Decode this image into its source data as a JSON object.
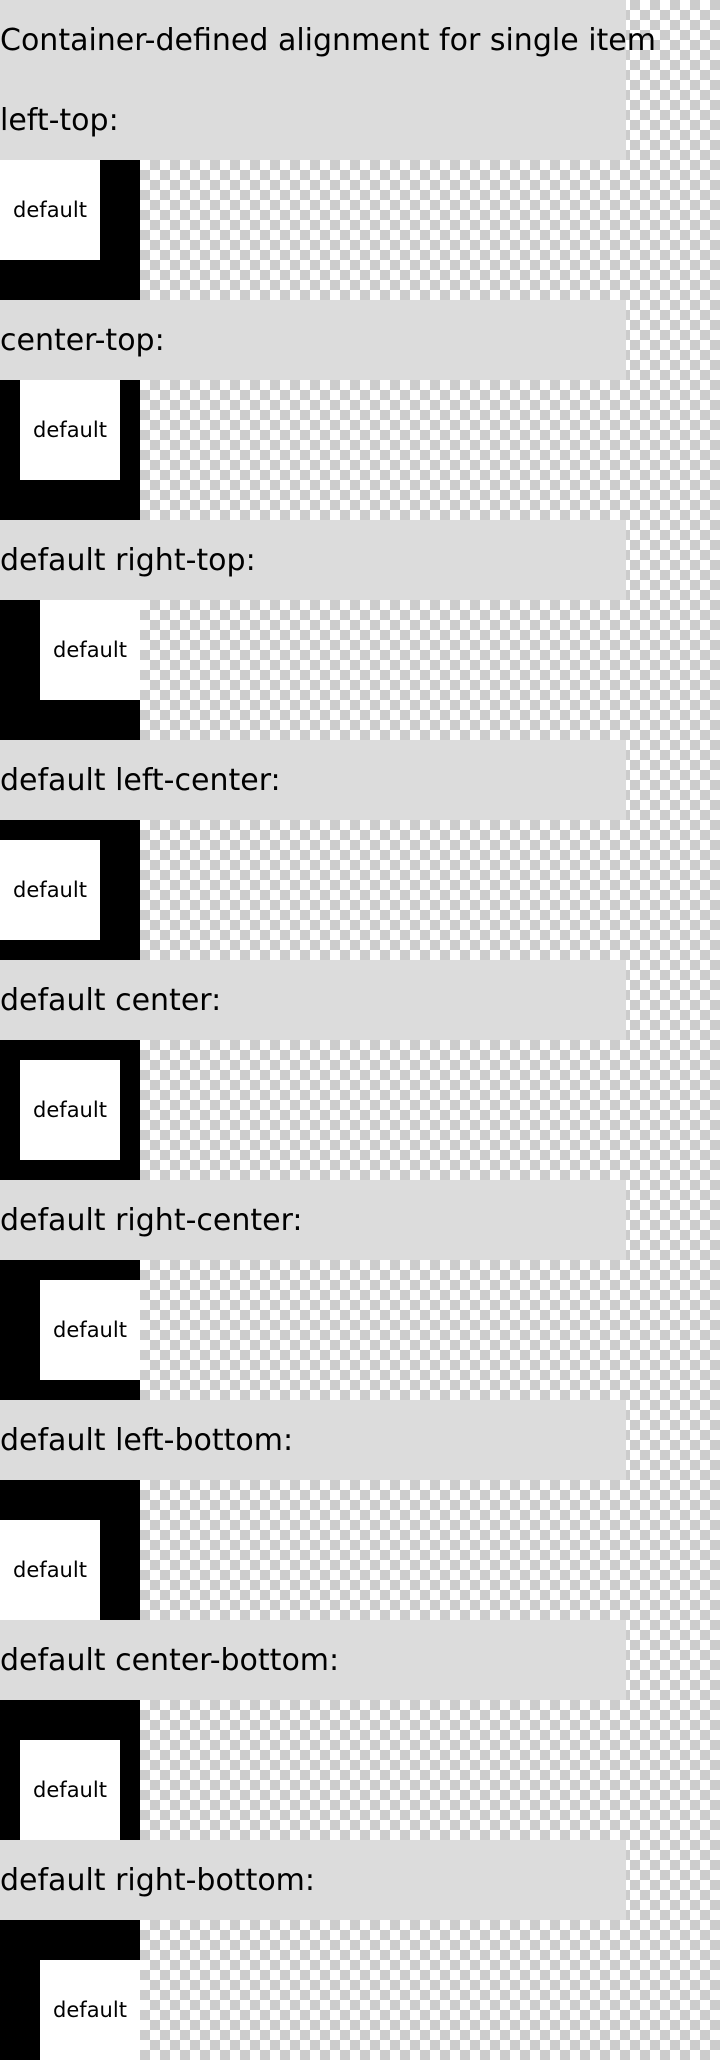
{
  "title": "Container-defined alignment for single item",
  "sections": [
    {
      "label": "left-top:",
      "item": "default"
    },
    {
      "label": "center-top:",
      "item": "default"
    },
    {
      "label": "default right-top:",
      "item": "default"
    },
    {
      "label": "default left-center:",
      "item": "default"
    },
    {
      "label": "default center:",
      "item": "default"
    },
    {
      "label": "default right-center:",
      "item": "default"
    },
    {
      "label": "default left-bottom:",
      "item": "default"
    },
    {
      "label": "default center-bottom:",
      "item": "default"
    },
    {
      "label": "default right-bottom:",
      "item": "default"
    }
  ],
  "colors": {
    "label_background": "#dcdcdc",
    "container_background": "#000000",
    "item_background": "#ffffff"
  }
}
